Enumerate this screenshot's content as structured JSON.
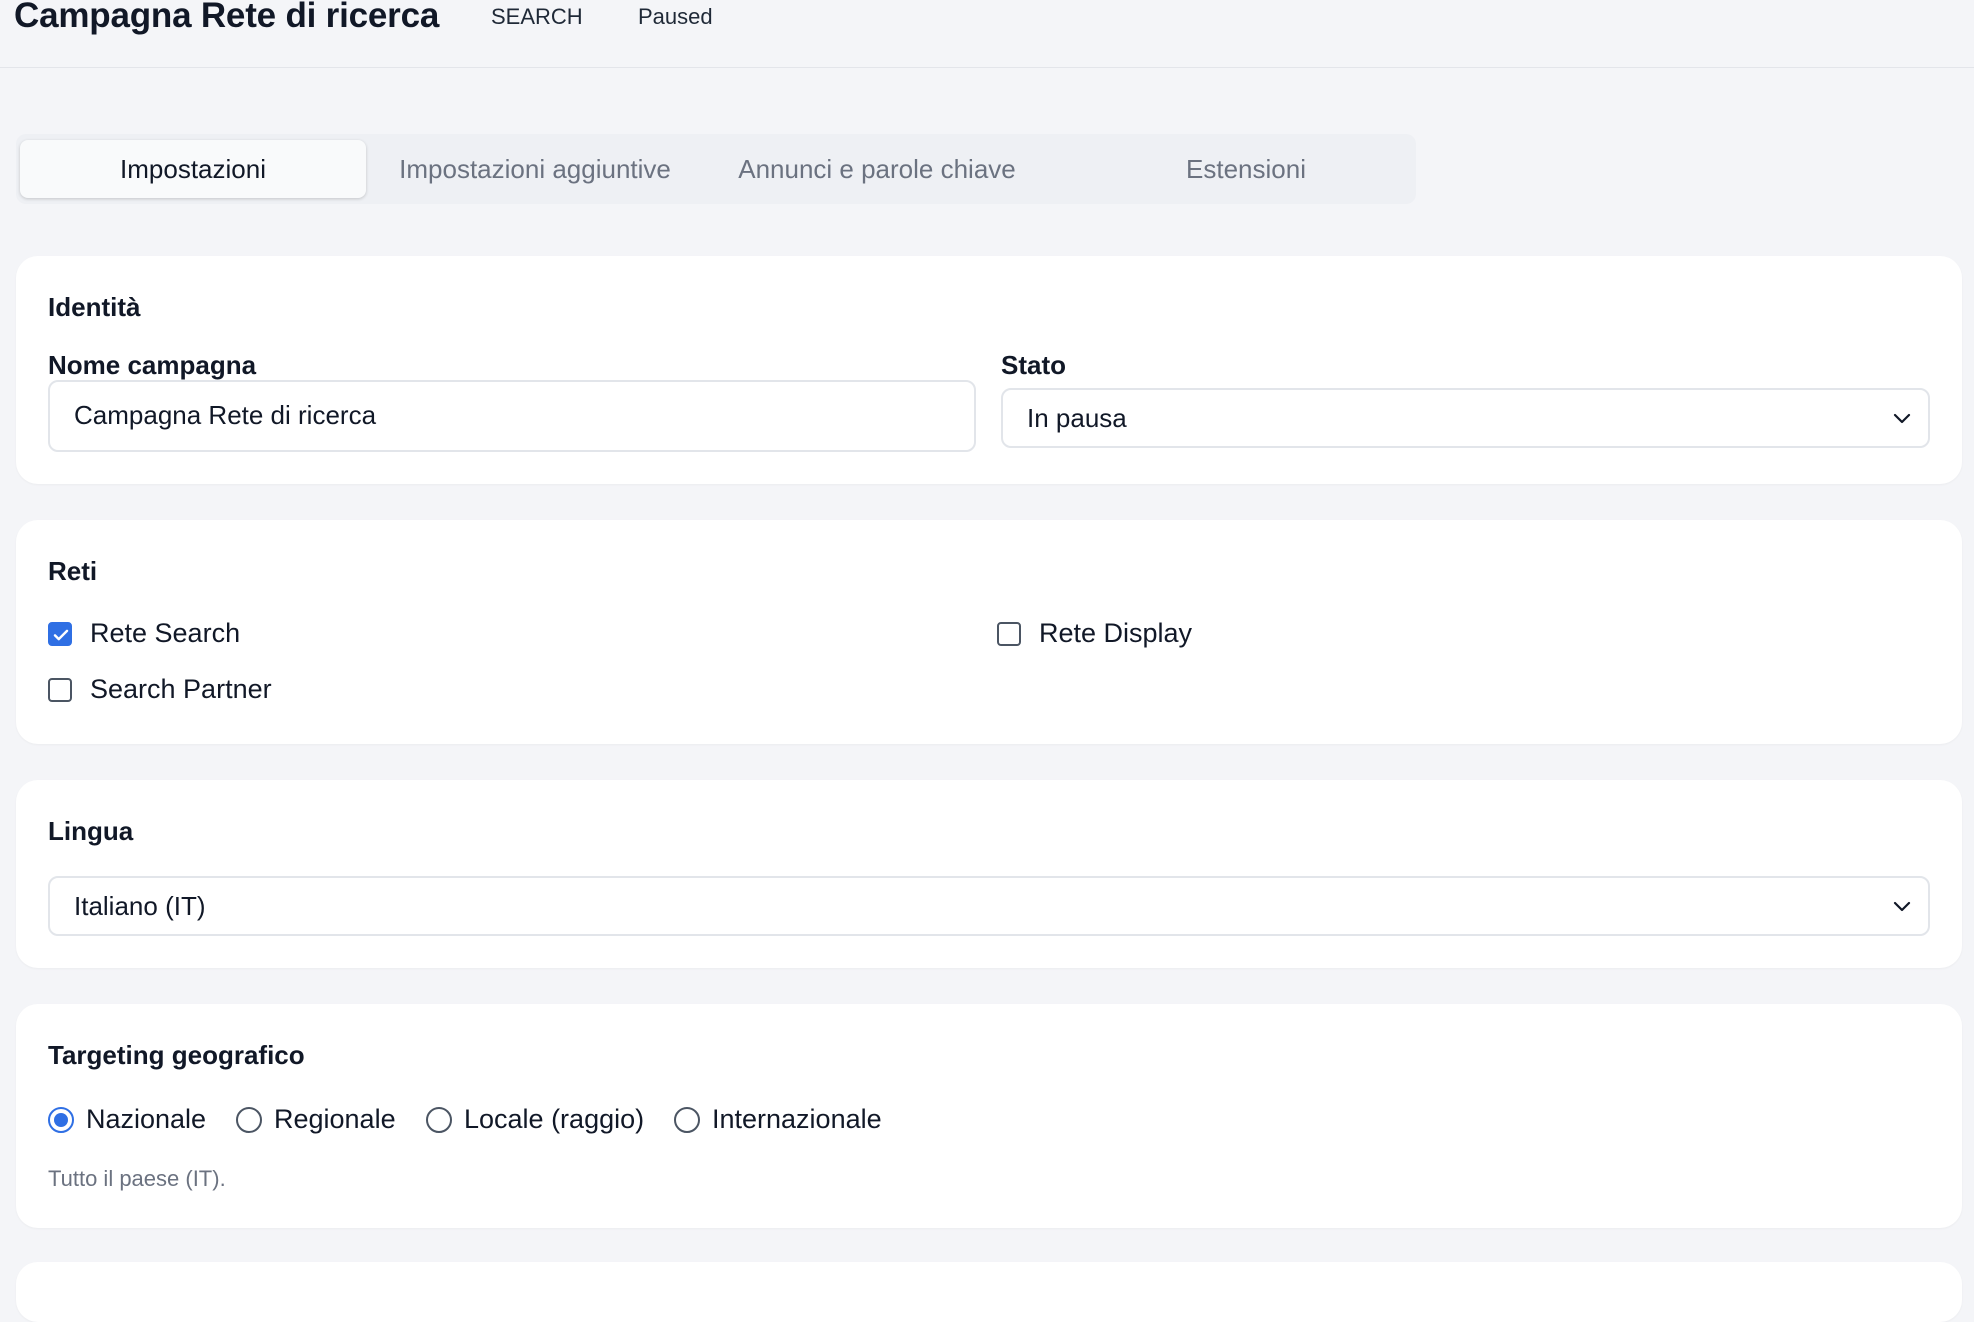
{
  "header": {
    "title": "Campagna Rete di ricerca",
    "type_chip": "SEARCH",
    "status_chip": "Paused"
  },
  "tabs": [
    {
      "label": "Impostazioni",
      "active": true
    },
    {
      "label": "Impostazioni aggiuntive",
      "active": false
    },
    {
      "label": "Annunci e parole chiave",
      "active": false
    },
    {
      "label": "Estensioni",
      "active": false
    }
  ],
  "identity": {
    "title": "Identità",
    "name_label": "Nome campagna",
    "name_value": "Campagna Rete di ricerca",
    "status_label": "Stato",
    "status_value": "In pausa"
  },
  "networks": {
    "title": "Reti",
    "options": [
      {
        "label": "Rete Search",
        "checked": true
      },
      {
        "label": "Rete Display",
        "checked": false
      },
      {
        "label": "Search Partner",
        "checked": false
      }
    ]
  },
  "language": {
    "title": "Lingua",
    "value": "Italiano (IT)"
  },
  "geo": {
    "title": "Targeting geografico",
    "options": [
      {
        "label": "Nazionale",
        "checked": true
      },
      {
        "label": "Regionale",
        "checked": false
      },
      {
        "label": "Locale (raggio)",
        "checked": false
      },
      {
        "label": "Internazionale",
        "checked": false
      }
    ],
    "help": "Tutto il paese (IT)."
  },
  "colors": {
    "accent": "#2f6fe4",
    "background": "#f4f5f8"
  }
}
